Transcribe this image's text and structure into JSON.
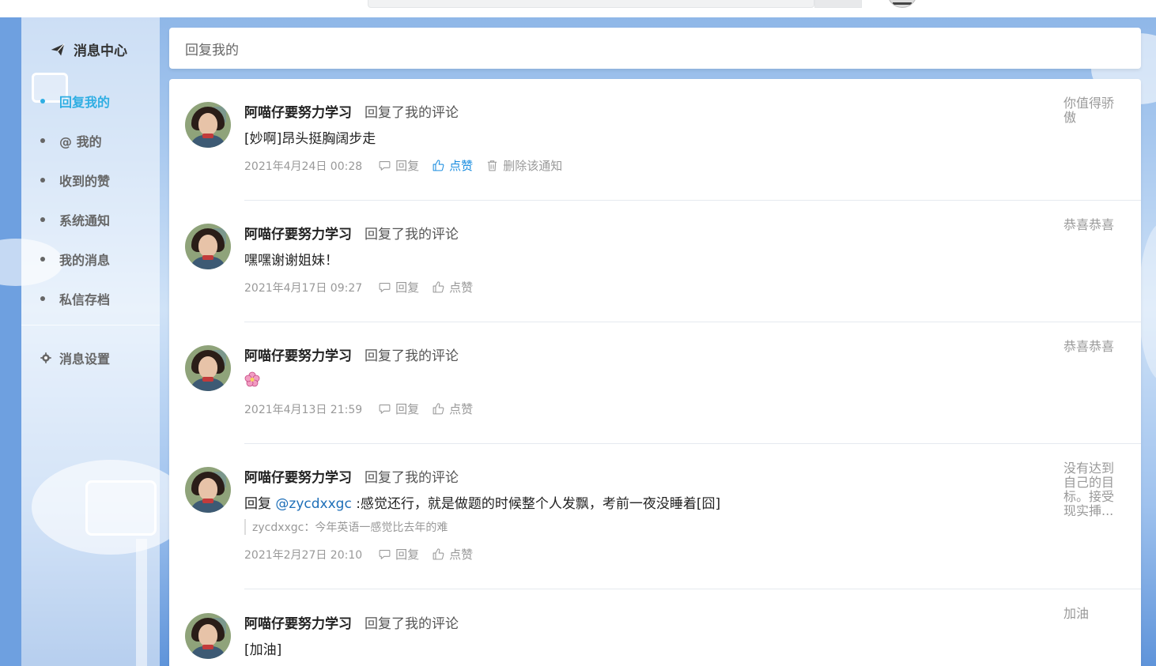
{
  "page": {
    "header_title": "回复我的"
  },
  "sidebar": {
    "title": "消息中心",
    "items": [
      {
        "label": "回复我的",
        "active": true
      },
      {
        "label": "@ 我的",
        "active": false
      },
      {
        "label": "收到的赞",
        "active": false
      },
      {
        "label": "系统通知",
        "active": false
      },
      {
        "label": "我的消息",
        "active": false
      },
      {
        "label": "私信存档",
        "active": false
      }
    ],
    "settings_label": "消息设置"
  },
  "actions": {
    "reply_label": "回复",
    "like_label": "点赞",
    "delete_label": "删除该通知"
  },
  "replies": [
    {
      "user": "阿喵仔要努力学习",
      "action": "回复了我的评论",
      "content": "[妙啊]昂头挺胸阔步走",
      "time": "2021年4月24日 00:28",
      "liked": true,
      "show_delete": true,
      "original": "你值得骄傲"
    },
    {
      "user": "阿喵仔要努力学习",
      "action": "回复了我的评论",
      "content": "嘿嘿谢谢姐妹！",
      "time": "2021年4月17日 09:27",
      "liked": false,
      "show_delete": false,
      "original": "恭喜恭喜"
    },
    {
      "user": "阿喵仔要努力学习",
      "action": "回复了我的评论",
      "content": "",
      "emoji": "flower",
      "time": "2021年4月13日 21:59",
      "liked": false,
      "show_delete": false,
      "original": "恭喜恭喜"
    },
    {
      "user": "阿喵仔要努力学习",
      "action": "回复了我的评论",
      "content_prefix": "回复 ",
      "mention": "@zycdxxgc",
      "content_suffix": " :感觉还行，就是做题的时候整个人发飘，考前一夜没睡着[囧]",
      "quote": "zycdxxgc：今年英语一感觉比去年的难",
      "time": "2021年2月27日 20:10",
      "liked": false,
      "show_delete": false,
      "original": "没有达到自己的目标。接受现实挿..."
    },
    {
      "user": "阿喵仔要努力学习",
      "action": "回复了我的评论",
      "content": "[加油]",
      "time": "",
      "liked": false,
      "show_delete": false,
      "original": "加油"
    }
  ],
  "colors": {
    "accent": "#2faee3",
    "link": "#1e6fb8",
    "liked": "#1e8fe0"
  }
}
